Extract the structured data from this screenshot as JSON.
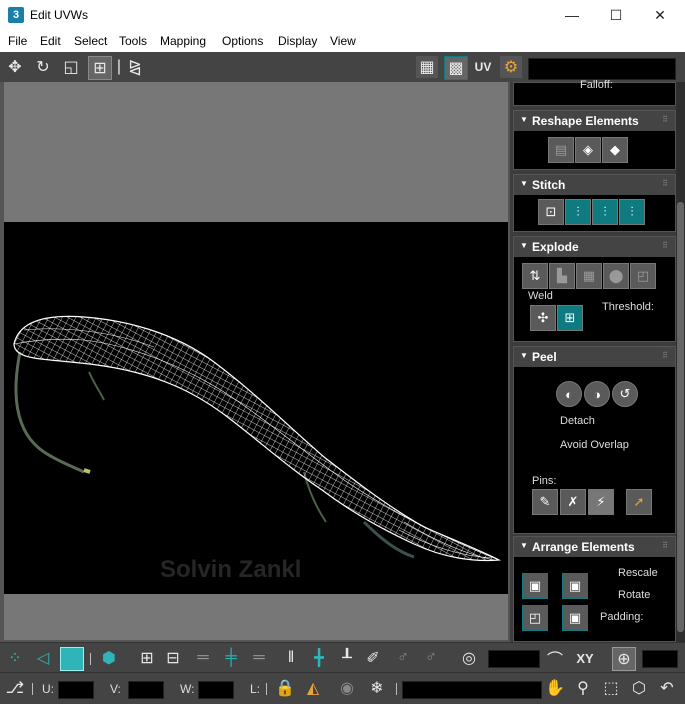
{
  "window": {
    "title": "Edit UVWs",
    "app_icon": "3",
    "controls": {
      "minimize": "—",
      "maximize": "☐",
      "close": "✕"
    }
  },
  "menu": [
    "File",
    "Edit",
    "Select",
    "Tools",
    "Mapping",
    "Options",
    "Display",
    "View"
  ],
  "toolbar_top": {
    "uv_label": "UV"
  },
  "viewport": {
    "watermark": "Solvin Zankl"
  },
  "panel": {
    "falloff": "Falloff:",
    "reshape": {
      "title": "Reshape Elements"
    },
    "stitch": {
      "title": "Stitch"
    },
    "explode": {
      "title": "Explode",
      "weld": "Weld",
      "threshold": "Threshold:"
    },
    "peel": {
      "title": "Peel",
      "detach": "Detach",
      "avoid_overlap": "Avoid Overlap",
      "pins": "Pins:"
    },
    "arrange": {
      "title": "Arrange Elements",
      "rescale": "Rescale",
      "rotate": "Rotate",
      "padding": "Padding:"
    }
  },
  "bottom": {
    "xy": "XY",
    "u": "U:",
    "v": "V:",
    "w": "W:",
    "l": "L:"
  },
  "colors": {
    "accent": "#0f7b80",
    "uv_background": "#000000",
    "wire": "#ffffff"
  }
}
